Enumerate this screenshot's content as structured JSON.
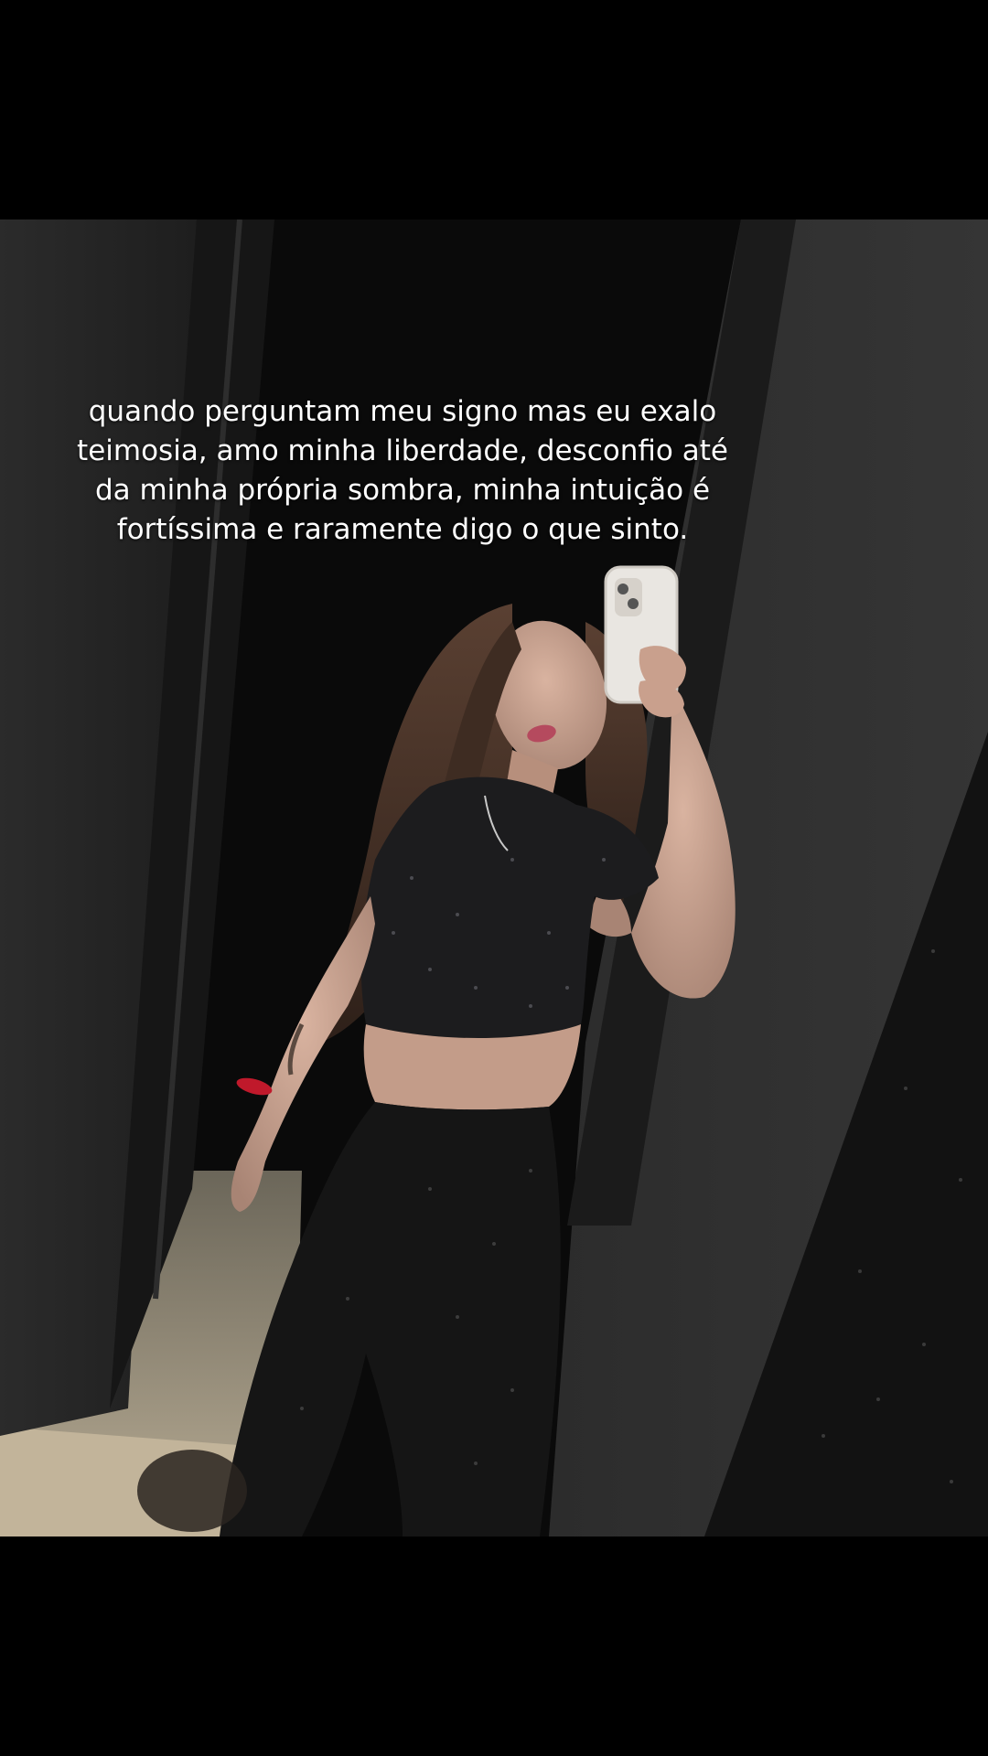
{
  "video": {
    "caption_lines": [
      "quando perguntam meu signo mas eu exalo",
      "teimosia, amo minha liberdade, desconfio até",
      "da minha própria sombra, minha intuição é",
      "fortíssima e raramente digo o que sinto."
    ]
  },
  "colors": {
    "background": "#000000",
    "wall": "#2a2a2a",
    "doorway": "#080808",
    "floor": "#a8a08c",
    "caption_text": "#ffffff"
  }
}
